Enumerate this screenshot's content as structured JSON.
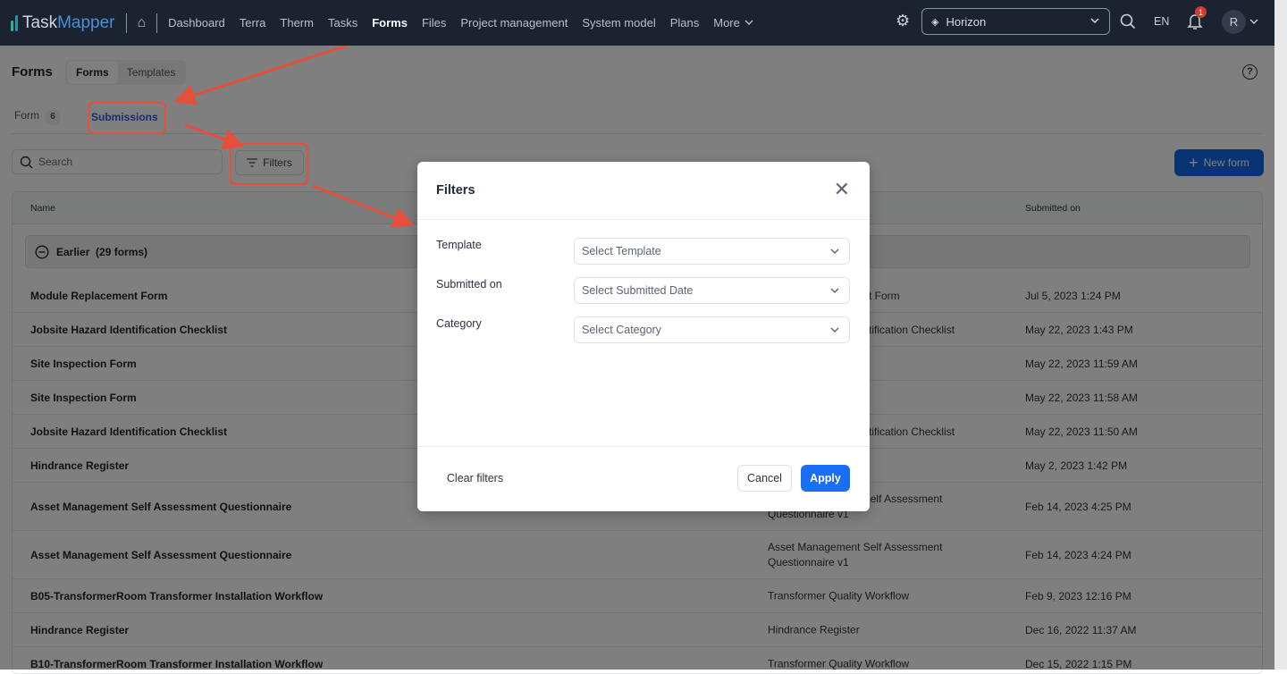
{
  "app": {
    "logo_a": "Task",
    "logo_b": "Mapper"
  },
  "nav": {
    "items": [
      "Dashboard",
      "Terra",
      "Therm",
      "Tasks",
      "Forms",
      "Files",
      "Project management",
      "System model",
      "Plans",
      "More"
    ],
    "active": "Forms",
    "project": "Horizon",
    "lang": "EN",
    "notifications": "1",
    "avatar": "R"
  },
  "page": {
    "title": "Forms",
    "segments": [
      "Forms",
      "Templates"
    ],
    "subtabs": {
      "form_label": "Form",
      "form_count": "6",
      "submissions_label": "Submissions"
    },
    "search_placeholder": "Search",
    "filters_label": "Filters",
    "new_form_label": "New form"
  },
  "table": {
    "col_name": "Name",
    "col_submitted": "Submitted on",
    "group": "Earlier  (29 forms)",
    "rows": [
      {
        "name": "Module Replacement Form",
        "template": "t Form",
        "date": "Jul 5, 2023 1:24 PM"
      },
      {
        "name": "Jobsite Hazard Identification Checklist",
        "template": "tification Checklist",
        "date": "May 22, 2023 1:43 PM"
      },
      {
        "name": "Site Inspection Form",
        "template": "",
        "date": "May 22, 2023 11:59 AM"
      },
      {
        "name": "Site Inspection Form",
        "template": "",
        "date": "May 22, 2023 11:58 AM"
      },
      {
        "name": "Jobsite Hazard Identification Checklist",
        "template": "tification Checklist",
        "date": "May 22, 2023 11:50 AM"
      },
      {
        "name": "Hindrance Register",
        "template": "",
        "date": "May 2, 2023 1:42 PM"
      },
      {
        "name": "Asset Management Self Assessment Questionnaire",
        "template": "Asset Management Self Assessment Questionnaire v1",
        "date": "Feb 14, 2023 4:25 PM"
      },
      {
        "name": "Asset Management Self Assessment Questionnaire",
        "template": "Asset Management Self Assessment Questionnaire v1",
        "date": "Feb 14, 2023 4:24 PM"
      },
      {
        "name": "B05-TransformerRoom Transformer Installation Workflow",
        "template": "Transformer Quality Workflow",
        "date": "Feb 9, 2023 12:16 PM"
      },
      {
        "name": "Hindrance Register",
        "template": "Hindrance Register",
        "date": "Dec 16, 2022 11:37 AM"
      },
      {
        "name": "B10-TransformerRoom Transformer Installation Workflow",
        "template": "Transformer Quality Workflow",
        "date": "Dec 15, 2022 1:15 PM"
      }
    ]
  },
  "modal": {
    "title": "Filters",
    "fields": [
      {
        "label": "Template",
        "placeholder": "Select Template"
      },
      {
        "label": "Submitted on",
        "placeholder": "Select Submitted Date"
      },
      {
        "label": "Category",
        "placeholder": "Select Category"
      }
    ],
    "clear": "Clear filters",
    "cancel": "Cancel",
    "apply": "Apply"
  },
  "colors": {
    "nav": "#1b2230",
    "primary": "#1466e8",
    "annotation": "#e4503c"
  }
}
